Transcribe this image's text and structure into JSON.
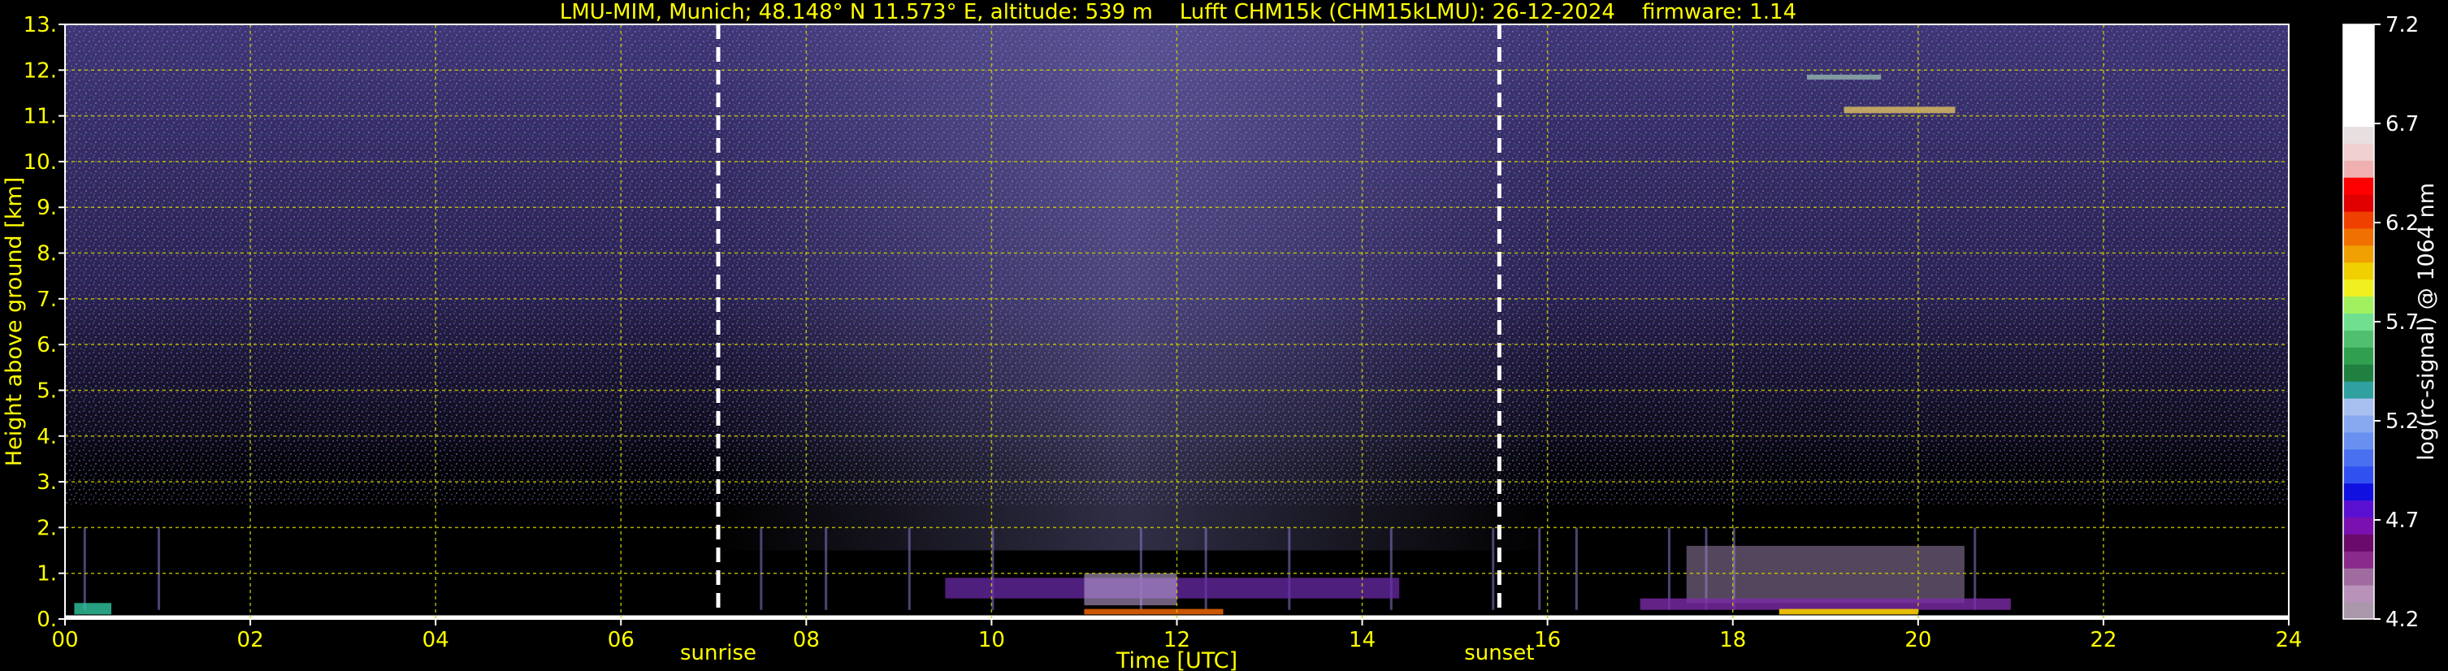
{
  "title": "LMU-MIM, Munich; 48.148° N 11.573° E, altitude: 539 m    Lufft CHM15k (CHM15kLMU): 26-12-2024    firmware: 1.14",
  "chart_data": {
    "type": "heatmap",
    "title": "LMU-MIM, Munich; 48.148° N 11.573° E, altitude: 539 m    Lufft CHM15k (CHM15kLMU): 26-12-2024    firmware: 1.14",
    "xlabel": "Time [UTC]",
    "ylabel": "Height above ground [km]",
    "xlim": [
      0,
      24
    ],
    "ylim": [
      0,
      13
    ],
    "x_ticks": [
      "00",
      "02",
      "04",
      "06",
      "08",
      "10",
      "12",
      "14",
      "16",
      "18",
      "20",
      "22",
      "24"
    ],
    "y_ticks": [
      "0.",
      "1.",
      "2.",
      "3.",
      "4.",
      "5.",
      "6.",
      "7.",
      "8.",
      "9.",
      "10.",
      "11.",
      "12.",
      "13."
    ],
    "grid": true,
    "sunrise_hour": 7.05,
    "sunset_hour": 15.48,
    "annotations": [
      "sunrise",
      "sunset"
    ],
    "colorbar": {
      "label": "log(rc-signal) @ 1064 nm",
      "range": [
        4.2,
        7.2
      ],
      "ticks": [
        "4.2",
        "4.7",
        "5.2",
        "5.7",
        "6.2",
        "6.7",
        "7.2"
      ]
    },
    "colors": {
      "background": "#000000",
      "text": "#ffff00",
      "grid": "#cccc00",
      "markers": "#ffffff"
    }
  }
}
